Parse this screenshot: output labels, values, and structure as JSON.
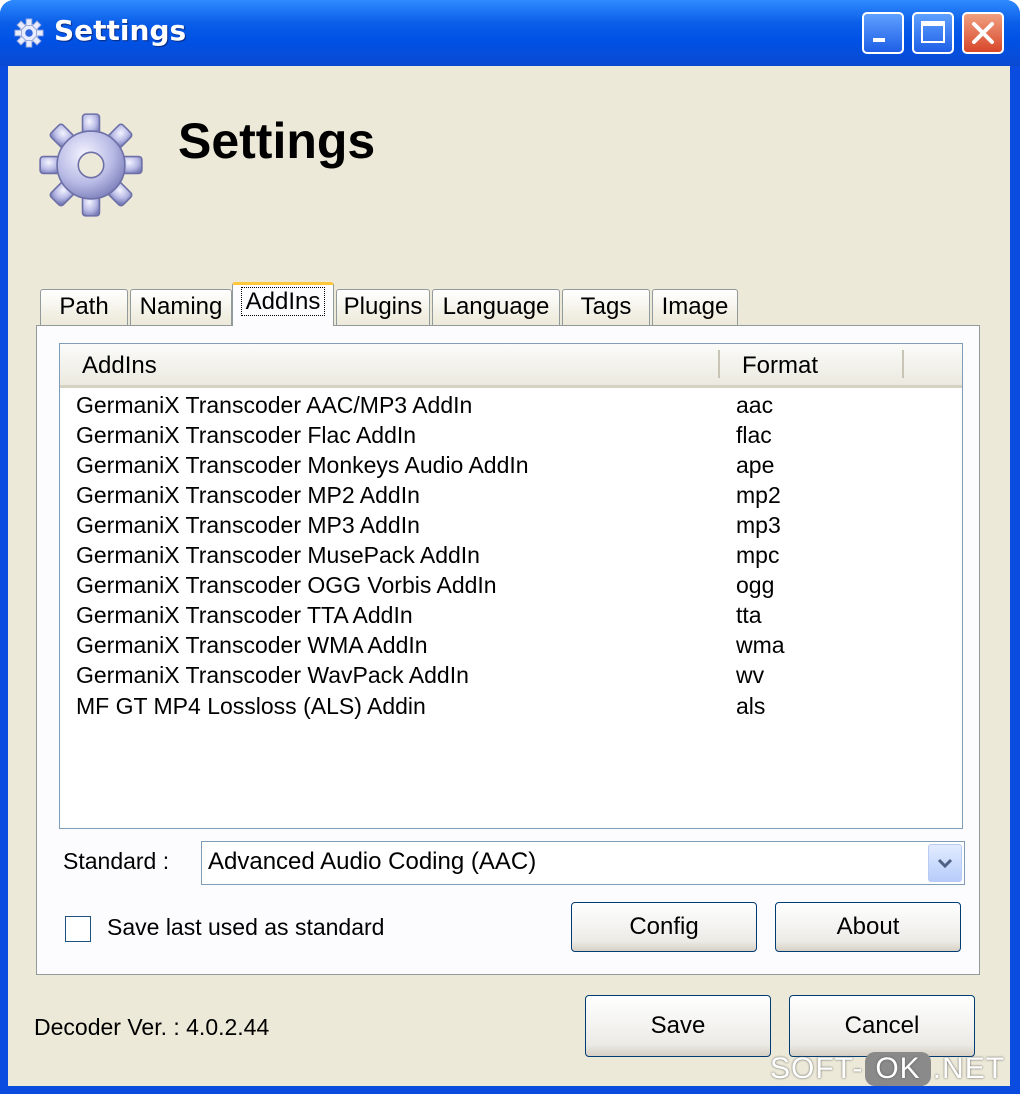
{
  "window": {
    "title": "Settings"
  },
  "header": {
    "heading": "Settings"
  },
  "tabs": [
    {
      "label": "Path"
    },
    {
      "label": "Naming"
    },
    {
      "label": "AddIns"
    },
    {
      "label": "Plugins"
    },
    {
      "label": "Language"
    },
    {
      "label": "Tags"
    },
    {
      "label": "Image"
    }
  ],
  "active_tab": "AddIns",
  "list": {
    "columns": [
      "AddIns",
      "Format"
    ],
    "rows": [
      {
        "name": "GermaniX Transcoder AAC/MP3 AddIn",
        "format": "aac"
      },
      {
        "name": "GermaniX Transcoder Flac AddIn",
        "format": "flac"
      },
      {
        "name": "GermaniX Transcoder Monkeys Audio AddIn",
        "format": "ape"
      },
      {
        "name": "GermaniX Transcoder MP2 AddIn",
        "format": "mp2"
      },
      {
        "name": "GermaniX Transcoder MP3 AddIn",
        "format": "mp3"
      },
      {
        "name": "GermaniX Transcoder MusePack AddIn",
        "format": "mpc"
      },
      {
        "name": "GermaniX Transcoder OGG Vorbis AddIn",
        "format": "ogg"
      },
      {
        "name": "GermaniX Transcoder TTA AddIn",
        "format": "tta"
      },
      {
        "name": "GermaniX Transcoder WMA AddIn",
        "format": "wma"
      },
      {
        "name": "GermaniX Transcoder WavPack AddIn",
        "format": "wv"
      },
      {
        "name": "MF GT MP4 Lossloss (ALS) Addin",
        "format": "als"
      }
    ]
  },
  "standard": {
    "label": "Standard :",
    "value": "Advanced Audio Coding (AAC)"
  },
  "save_last": {
    "label": "Save last used as standard",
    "checked": false
  },
  "buttons": {
    "config": "Config",
    "about": "About",
    "save": "Save",
    "cancel": "Cancel"
  },
  "footer": {
    "version": "Decoder Ver. : 4.0.2.44"
  },
  "watermark": {
    "part1": "SOFT-",
    "part2": "OK",
    "part3": ".NET"
  },
  "colors": {
    "titlebar": "#0a5ee8",
    "dialog_bg": "#ece9d8",
    "tab_highlight": "#ffc83c"
  },
  "icons": {
    "title": "gear-icon",
    "header": "gear-icon"
  }
}
